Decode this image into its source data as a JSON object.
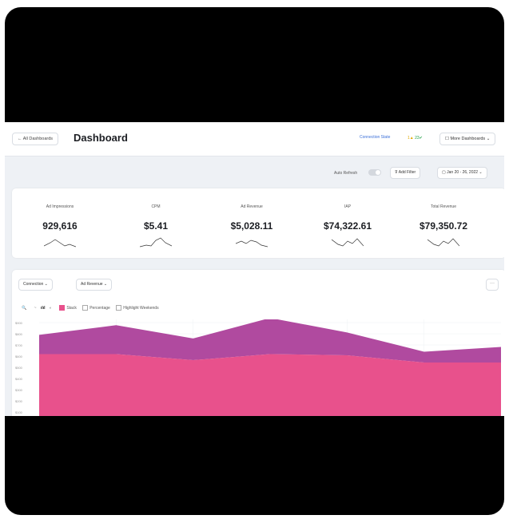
{
  "header": {
    "back_label": "← All Dashboards",
    "title": "Dashboard",
    "connection_label": "Connection State",
    "warn_count": "1▲",
    "ok_count": "23✔",
    "more_label": "☐ More Dashboards ⌄"
  },
  "filters": {
    "auto_refresh_label": "Auto Refresh",
    "auto_refresh_on": false,
    "add_filter_label": "⊽ Add Filter",
    "date_label": "▢ Jan 20 - 26, 2022 ⌄"
  },
  "metrics": [
    {
      "label": "Ad Impressions",
      "value": "929,616"
    },
    {
      "label": "CPM",
      "value": "$5.41"
    },
    {
      "label": "Ad Revenue",
      "value": "$5,028.11"
    },
    {
      "label": "IAP",
      "value": "$74,322.61"
    },
    {
      "label": "Total Revenue",
      "value": "$79,350.72"
    }
  ],
  "chart_controls": {
    "dimension_label": "Connection ⌄",
    "metric_label": "Ad Revenue ⌄",
    "menu_label": "···",
    "zoom_icon": "zoom-icon",
    "chart_modes": [
      "~",
      "ılıl",
      "◐"
    ],
    "stack_label": "Stack",
    "percentage_label": "Percentage",
    "highlight_label": "Highlight Weekends"
  },
  "chart_data": {
    "type": "area",
    "stacked": true,
    "y_ticks": [
      "$900",
      "$800",
      "$700",
      "$600",
      "$500",
      "$400",
      "$300",
      "$200",
      "$100"
    ],
    "x": [
      0,
      1,
      2,
      3,
      4,
      5,
      6
    ],
    "series": [
      {
        "values": [
          560,
          560,
          510,
          560,
          550,
          490,
          490
        ],
        "color": "#e8518c"
      },
      {
        "values": [
          160,
          240,
          180,
          300,
          190,
          90,
          130
        ],
        "color": "#b04a9f"
      }
    ],
    "ylim": [
      0,
      950
    ]
  }
}
